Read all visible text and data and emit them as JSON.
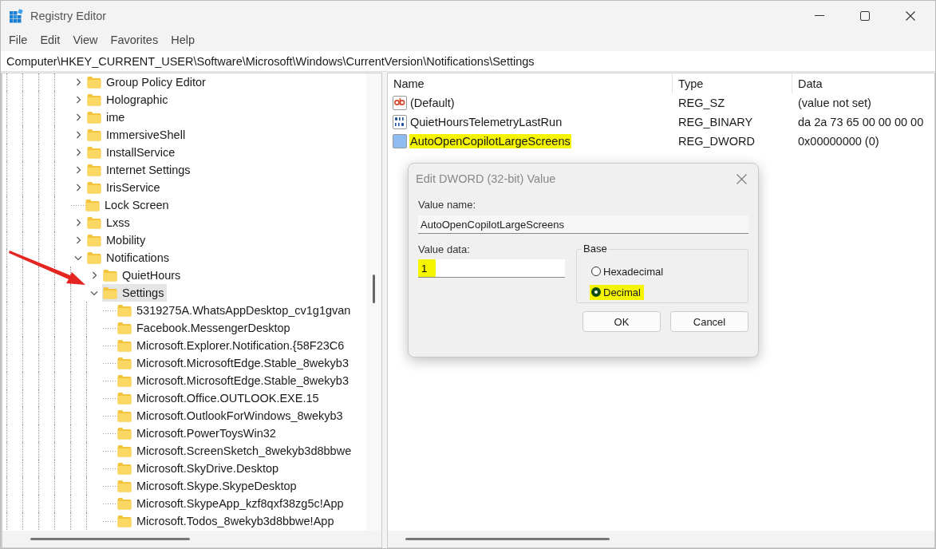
{
  "window": {
    "title": "Registry Editor"
  },
  "menu": [
    "File",
    "Edit",
    "View",
    "Favorites",
    "Help"
  ],
  "address": "Computer\\HKEY_CURRENT_USER\\Software\\Microsoft\\Windows\\CurrentVersion\\Notifications\\Settings",
  "tree": [
    {
      "label": "Group Policy Editor",
      "kind": "node",
      "expanded": false,
      "selected": false
    },
    {
      "label": "Holographic",
      "kind": "node",
      "expanded": false,
      "selected": false
    },
    {
      "label": "ime",
      "kind": "node",
      "expanded": false,
      "selected": false
    },
    {
      "label": "ImmersiveShell",
      "kind": "node",
      "expanded": false,
      "selected": false
    },
    {
      "label": "InstallService",
      "kind": "node",
      "expanded": false,
      "selected": false
    },
    {
      "label": "Internet Settings",
      "kind": "node",
      "expanded": false,
      "selected": false
    },
    {
      "label": "IrisService",
      "kind": "node",
      "expanded": false,
      "selected": false
    },
    {
      "label": "Lock Screen",
      "kind": "leaf",
      "selected": false
    },
    {
      "label": "Lxss",
      "kind": "node",
      "expanded": false,
      "selected": false
    },
    {
      "label": "Mobility",
      "kind": "node",
      "expanded": false,
      "selected": false
    },
    {
      "label": "Notifications",
      "kind": "node",
      "expanded": true,
      "selected": false,
      "children": [
        {
          "label": "QuietHours",
          "kind": "node",
          "expanded": false,
          "selected": false
        },
        {
          "label": "Settings",
          "kind": "node",
          "expanded": true,
          "selected": true,
          "children": [
            {
              "label": "5319275A.WhatsAppDesktop_cv1g1gvan",
              "kind": "leaf",
              "selected": false
            },
            {
              "label": "Facebook.MessengerDesktop",
              "kind": "leaf",
              "selected": false
            },
            {
              "label": "Microsoft.Explorer.Notification.{58F23C6",
              "kind": "leaf",
              "selected": false
            },
            {
              "label": "Microsoft.MicrosoftEdge.Stable_8wekyb3",
              "kind": "leaf",
              "selected": false
            },
            {
              "label": "Microsoft.MicrosoftEdge.Stable_8wekyb3",
              "kind": "leaf",
              "selected": false
            },
            {
              "label": "Microsoft.Office.OUTLOOK.EXE.15",
              "kind": "leaf",
              "selected": false
            },
            {
              "label": "Microsoft.OutlookForWindows_8wekyb3",
              "kind": "leaf",
              "selected": false
            },
            {
              "label": "Microsoft.PowerToysWin32",
              "kind": "leaf",
              "selected": false
            },
            {
              "label": "Microsoft.ScreenSketch_8wekyb3d8bbwe",
              "kind": "leaf",
              "selected": false
            },
            {
              "label": "Microsoft.SkyDrive.Desktop",
              "kind": "leaf",
              "selected": false
            },
            {
              "label": "Microsoft.Skype.SkypeDesktop",
              "kind": "leaf",
              "selected": false
            },
            {
              "label": "Microsoft.SkypeApp_kzf8qxf38zg5c!App",
              "kind": "leaf",
              "selected": false
            },
            {
              "label": "Microsoft.Todos_8wekyb3d8bbwe!App",
              "kind": "leaf",
              "selected": false
            }
          ]
        }
      ]
    }
  ],
  "values": {
    "columns": [
      "Name",
      "Type",
      "Data"
    ],
    "rows": [
      {
        "kind": "string",
        "name": "(Default)",
        "type": "REG_SZ",
        "data": "(value not set)",
        "selected": false,
        "highlighted": false
      },
      {
        "kind": "binary",
        "name": "QuietHoursTelemetryLastRun",
        "type": "REG_BINARY",
        "data": "da 2a 73 65 00 00 00 00",
        "selected": false,
        "highlighted": false
      },
      {
        "kind": "binary",
        "name": "AutoOpenCopilotLargeScreens",
        "type": "REG_DWORD",
        "data": "0x00000000 (0)",
        "selected": true,
        "highlighted": true
      }
    ]
  },
  "dialog": {
    "title": "Edit DWORD (32-bit) Value",
    "value_name_label": "Value name:",
    "value_name": "AutoOpenCopilotLargeScreens",
    "value_data_label": "Value data:",
    "value_data": "1",
    "value_data_highlighted": true,
    "base_label": "Base",
    "bases": [
      {
        "label": "Hexadecimal",
        "selected": false,
        "highlighted": false
      },
      {
        "label": "Decimal",
        "selected": true,
        "highlighted": true
      }
    ],
    "buttons": [
      "OK",
      "Cancel"
    ]
  }
}
